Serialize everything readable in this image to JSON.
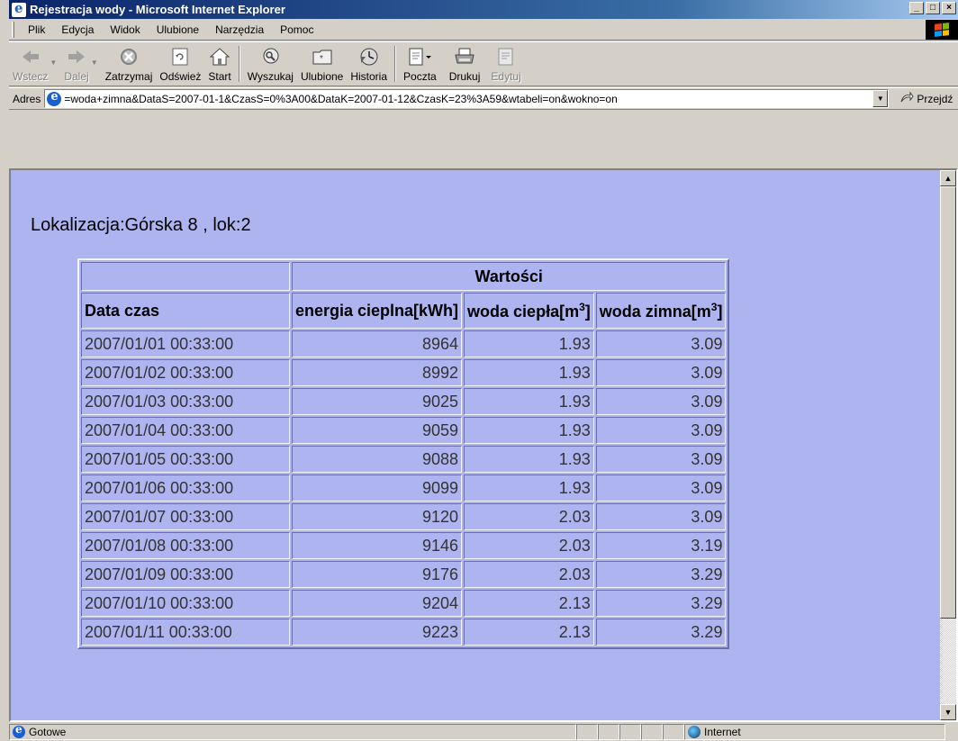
{
  "window": {
    "title": "Rejestracja wody - Microsoft Internet Explorer"
  },
  "menu": [
    "Plik",
    "Edycja",
    "Widok",
    "Ulubione",
    "Narzędzia",
    "Pomoc"
  ],
  "toolbar": {
    "back": "Wstecz",
    "forward": "Dalej",
    "stop": "Zatrzymaj",
    "refresh": "Odśwież",
    "home": "Start",
    "search": "Wyszukaj",
    "favorites": "Ulubione",
    "history": "Historia",
    "mail": "Poczta",
    "print": "Drukuj",
    "edit": "Edytuj"
  },
  "address": {
    "label": "Adres",
    "url": "=woda+zimna&DataS=2007-01-1&CzasS=0%3A00&DataK=2007-01-12&CzasK=23%3A59&wtabeli=on&wokno=on",
    "go": "Przejdź"
  },
  "page": {
    "location": "Lokalizacja:Górska 8 , lok:2",
    "group_header": "Wartości",
    "col_date": "Data czas",
    "col_energy": "energia cieplna[kWh]",
    "col_hot": "woda ciepła[m",
    "col_cold": "woda zimna[m",
    "unit_sup": "3",
    "unit_close": "]",
    "rows": [
      [
        "2007/01/01 00:33:00",
        "8964",
        "1.93",
        "3.09"
      ],
      [
        "2007/01/02 00:33:00",
        "8992",
        "1.93",
        "3.09"
      ],
      [
        "2007/01/03 00:33:00",
        "9025",
        "1.93",
        "3.09"
      ],
      [
        "2007/01/04 00:33:00",
        "9059",
        "1.93",
        "3.09"
      ],
      [
        "2007/01/05 00:33:00",
        "9088",
        "1.93",
        "3.09"
      ],
      [
        "2007/01/06 00:33:00",
        "9099",
        "1.93",
        "3.09"
      ],
      [
        "2007/01/07 00:33:00",
        "9120",
        "2.03",
        "3.09"
      ],
      [
        "2007/01/08 00:33:00",
        "9146",
        "2.03",
        "3.19"
      ],
      [
        "2007/01/09 00:33:00",
        "9176",
        "2.03",
        "3.29"
      ],
      [
        "2007/01/10 00:33:00",
        "9204",
        "2.13",
        "3.29"
      ],
      [
        "2007/01/11 00:33:00",
        "9223",
        "2.13",
        "3.29"
      ]
    ]
  },
  "status": {
    "text": "Gotowe",
    "zone": "Internet"
  }
}
